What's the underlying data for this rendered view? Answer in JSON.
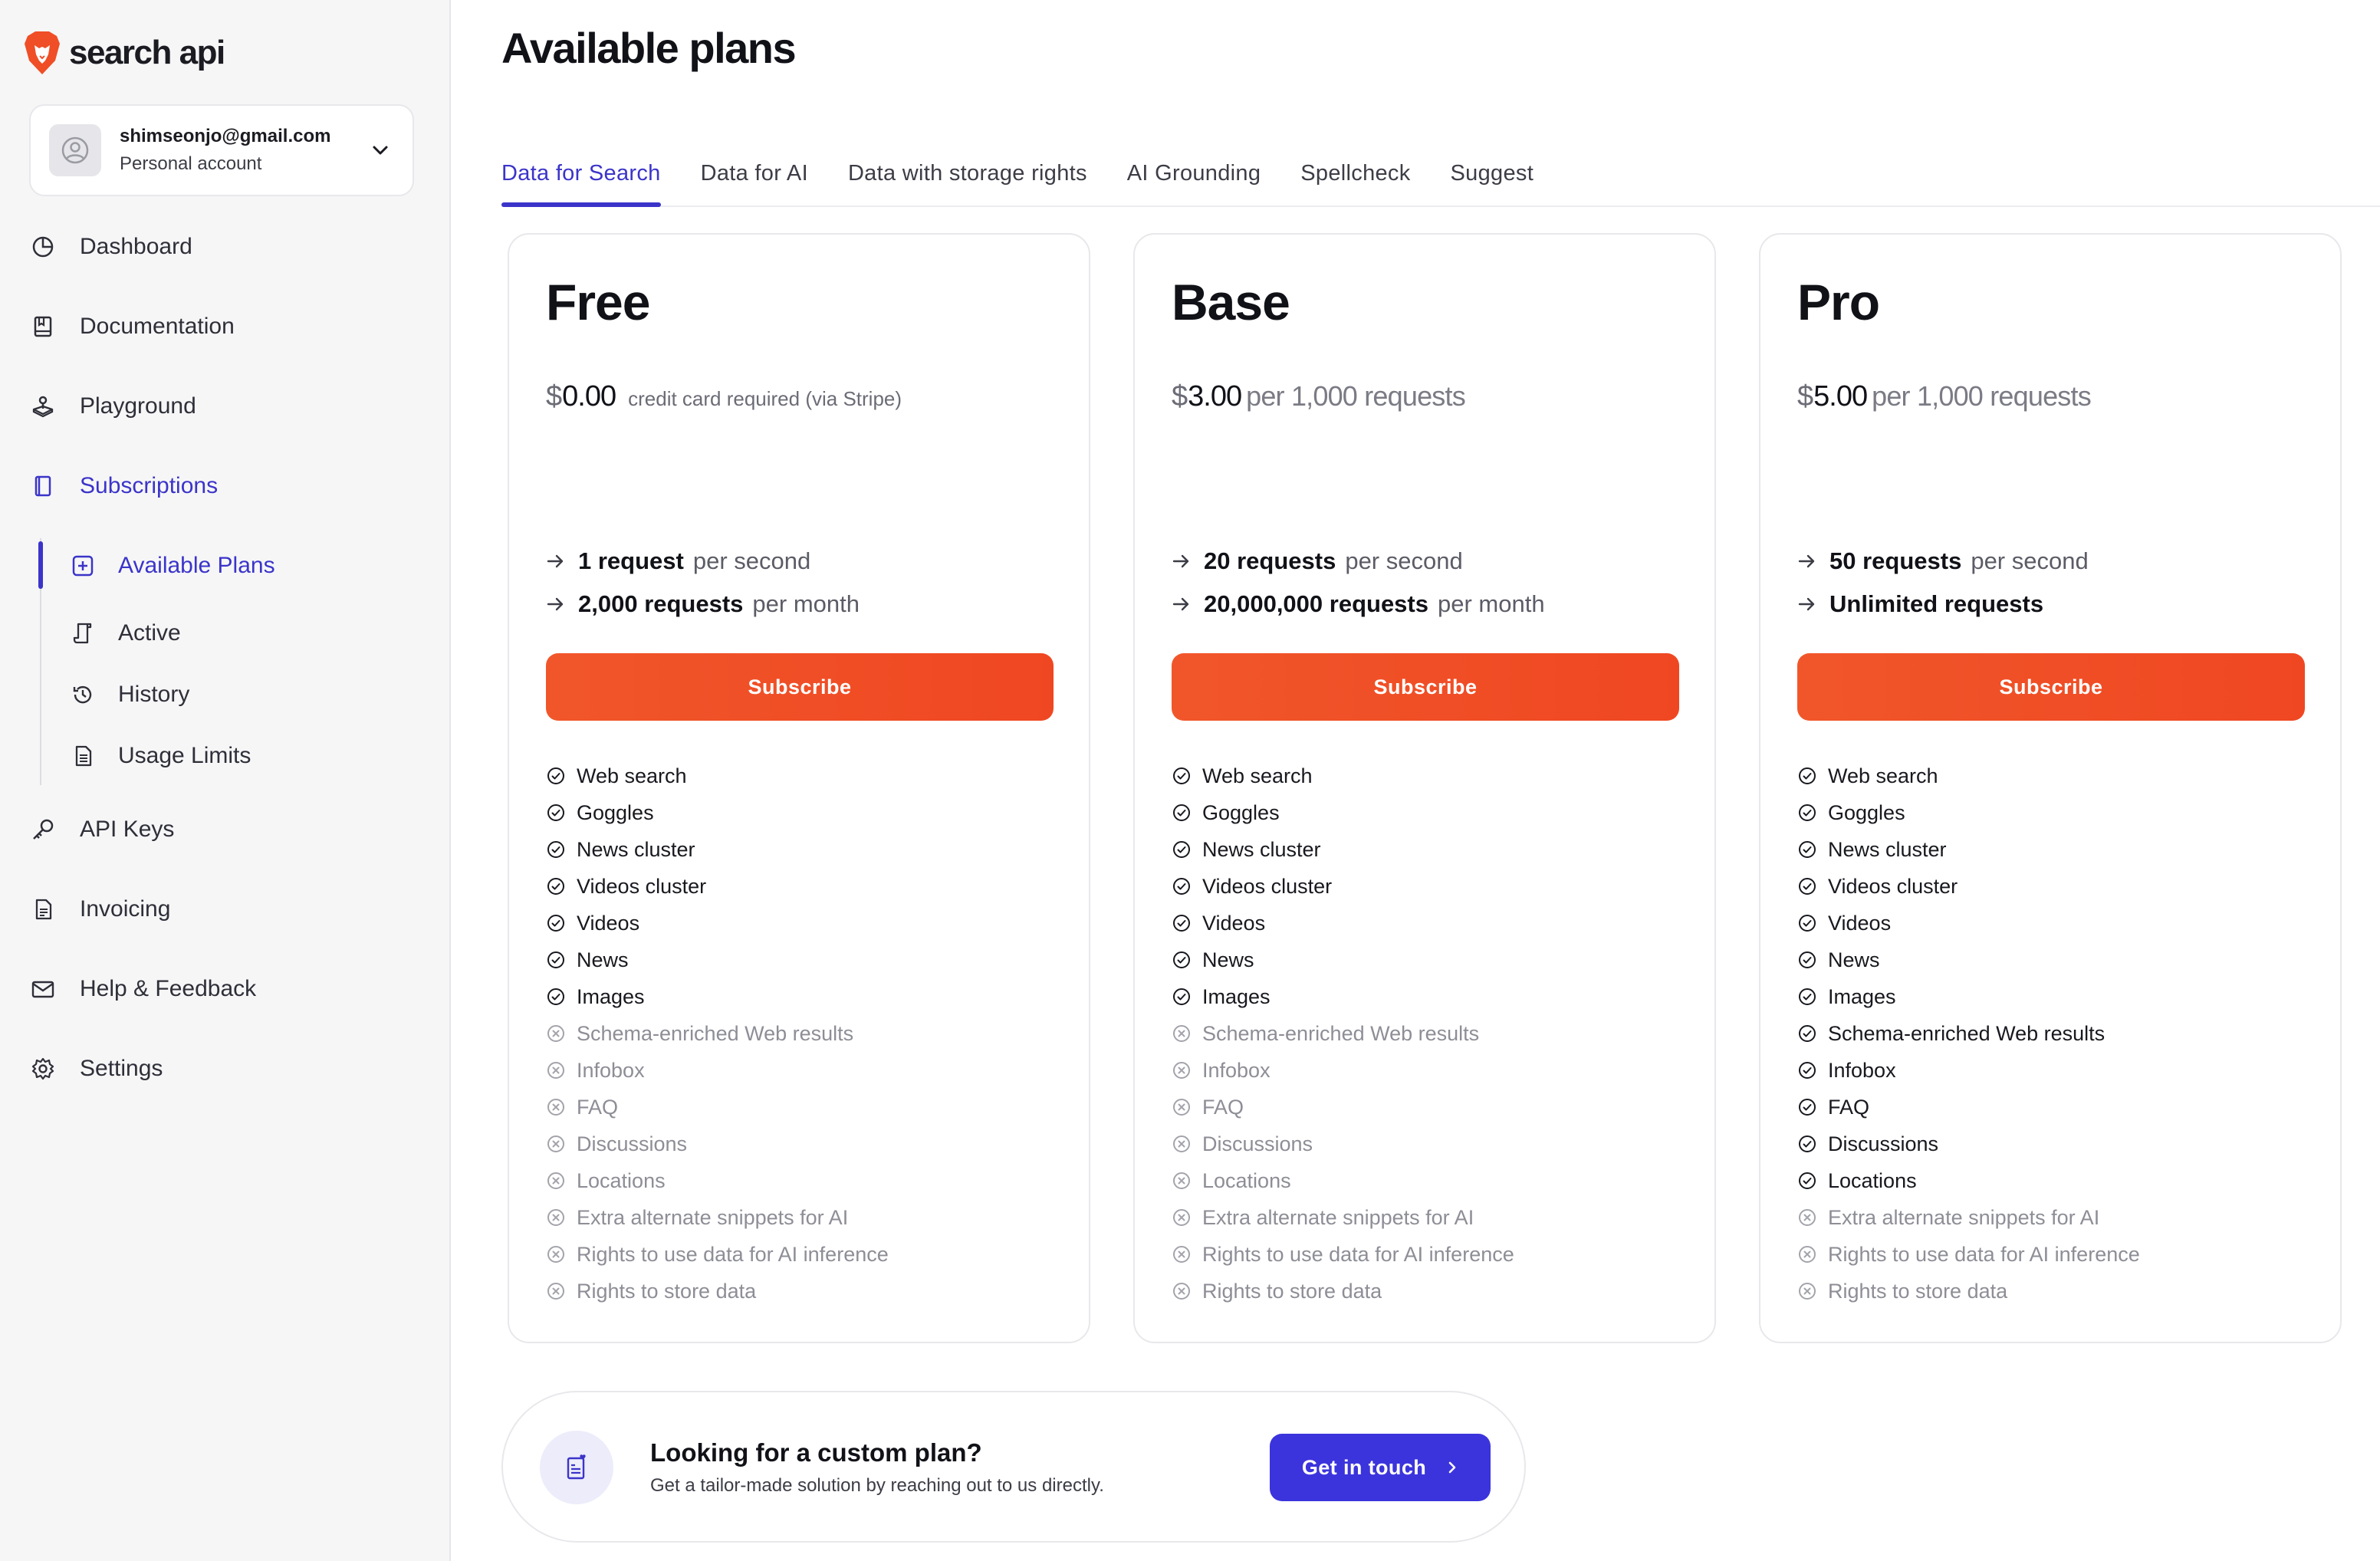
{
  "brand": {
    "name": "search api",
    "accent": "#3b34c9",
    "orange": "#f04e26"
  },
  "account": {
    "email": "shimseonjo@gmail.com",
    "type": "Personal account"
  },
  "sidebar": {
    "items": [
      {
        "label": "Dashboard",
        "icon": "dashboard-icon"
      },
      {
        "label": "Documentation",
        "icon": "book-icon"
      },
      {
        "label": "Playground",
        "icon": "joystick-icon"
      },
      {
        "label": "Subscriptions",
        "icon": "subscriptions-icon",
        "active": true
      },
      {
        "label": "API Keys",
        "icon": "key-icon"
      },
      {
        "label": "Invoicing",
        "icon": "invoice-icon"
      },
      {
        "label": "Help & Feedback",
        "icon": "mail-icon"
      },
      {
        "label": "Settings",
        "icon": "gear-icon"
      }
    ],
    "subitems": [
      {
        "label": "Available Plans",
        "icon": "plus-square-icon",
        "active": true
      },
      {
        "label": "Active",
        "icon": "scroll-icon"
      },
      {
        "label": "History",
        "icon": "history-icon"
      },
      {
        "label": "Usage Limits",
        "icon": "document-icon"
      }
    ]
  },
  "page": {
    "title": "Available plans"
  },
  "tabs": [
    {
      "label": "Data for Search",
      "active": true
    },
    {
      "label": "Data for AI"
    },
    {
      "label": "Data with storage rights"
    },
    {
      "label": "AI Grounding"
    },
    {
      "label": "Spellcheck"
    },
    {
      "label": "Suggest"
    }
  ],
  "plans": [
    {
      "name": "Free",
      "currency": "$",
      "price": "0.00",
      "price_note": "credit card required (via Stripe)",
      "limits": [
        {
          "strong": "1 request",
          "weak": "per second"
        },
        {
          "strong": "2,000 requests",
          "weak": "per month"
        }
      ],
      "button": "Subscribe",
      "features": [
        {
          "label": "Web search",
          "included": true
        },
        {
          "label": "Goggles",
          "included": true
        },
        {
          "label": "News cluster",
          "included": true
        },
        {
          "label": "Videos cluster",
          "included": true
        },
        {
          "label": "Videos",
          "included": true
        },
        {
          "label": "News",
          "included": true
        },
        {
          "label": "Images",
          "included": true
        },
        {
          "label": "Schema-enriched Web results",
          "included": false
        },
        {
          "label": "Infobox",
          "included": false
        },
        {
          "label": "FAQ",
          "included": false
        },
        {
          "label": "Discussions",
          "included": false
        },
        {
          "label": "Locations",
          "included": false
        },
        {
          "label": "Extra alternate snippets for AI",
          "included": false
        },
        {
          "label": "Rights to use data for AI inference",
          "included": false
        },
        {
          "label": "Rights to store data",
          "included": false
        }
      ]
    },
    {
      "name": "Base",
      "currency": "$",
      "price": "3.00",
      "price_note": "per 1,000 requests",
      "limits": [
        {
          "strong": "20 requests",
          "weak": "per second"
        },
        {
          "strong": "20,000,000 requests",
          "weak": "per month"
        }
      ],
      "button": "Subscribe",
      "features": [
        {
          "label": "Web search",
          "included": true
        },
        {
          "label": "Goggles",
          "included": true
        },
        {
          "label": "News cluster",
          "included": true
        },
        {
          "label": "Videos cluster",
          "included": true
        },
        {
          "label": "Videos",
          "included": true
        },
        {
          "label": "News",
          "included": true
        },
        {
          "label": "Images",
          "included": true
        },
        {
          "label": "Schema-enriched Web results",
          "included": false
        },
        {
          "label": "Infobox",
          "included": false
        },
        {
          "label": "FAQ",
          "included": false
        },
        {
          "label": "Discussions",
          "included": false
        },
        {
          "label": "Locations",
          "included": false
        },
        {
          "label": "Extra alternate snippets for AI",
          "included": false
        },
        {
          "label": "Rights to use data for AI inference",
          "included": false
        },
        {
          "label": "Rights to store data",
          "included": false
        }
      ]
    },
    {
      "name": "Pro",
      "currency": "$",
      "price": "5.00",
      "price_note": "per 1,000 requests",
      "limits": [
        {
          "strong": "50 requests",
          "weak": "per second"
        },
        {
          "strong": "Unlimited requests",
          "weak": ""
        }
      ],
      "button": "Subscribe",
      "features": [
        {
          "label": "Web search",
          "included": true
        },
        {
          "label": "Goggles",
          "included": true
        },
        {
          "label": "News cluster",
          "included": true
        },
        {
          "label": "Videos cluster",
          "included": true
        },
        {
          "label": "Videos",
          "included": true
        },
        {
          "label": "News",
          "included": true
        },
        {
          "label": "Images",
          "included": true
        },
        {
          "label": "Schema-enriched Web results",
          "included": true
        },
        {
          "label": "Infobox",
          "included": true
        },
        {
          "label": "FAQ",
          "included": true
        },
        {
          "label": "Discussions",
          "included": true
        },
        {
          "label": "Locations",
          "included": true
        },
        {
          "label": "Extra alternate snippets for AI",
          "included": false
        },
        {
          "label": "Rights to use data for AI inference",
          "included": false
        },
        {
          "label": "Rights to store data",
          "included": false
        }
      ]
    }
  ],
  "custom_plan": {
    "title": "Looking for a custom plan?",
    "subtitle": "Get a tailor-made solution by reaching out to us directly.",
    "button": "Get in touch",
    "icon": "clipboard-heart-icon"
  }
}
